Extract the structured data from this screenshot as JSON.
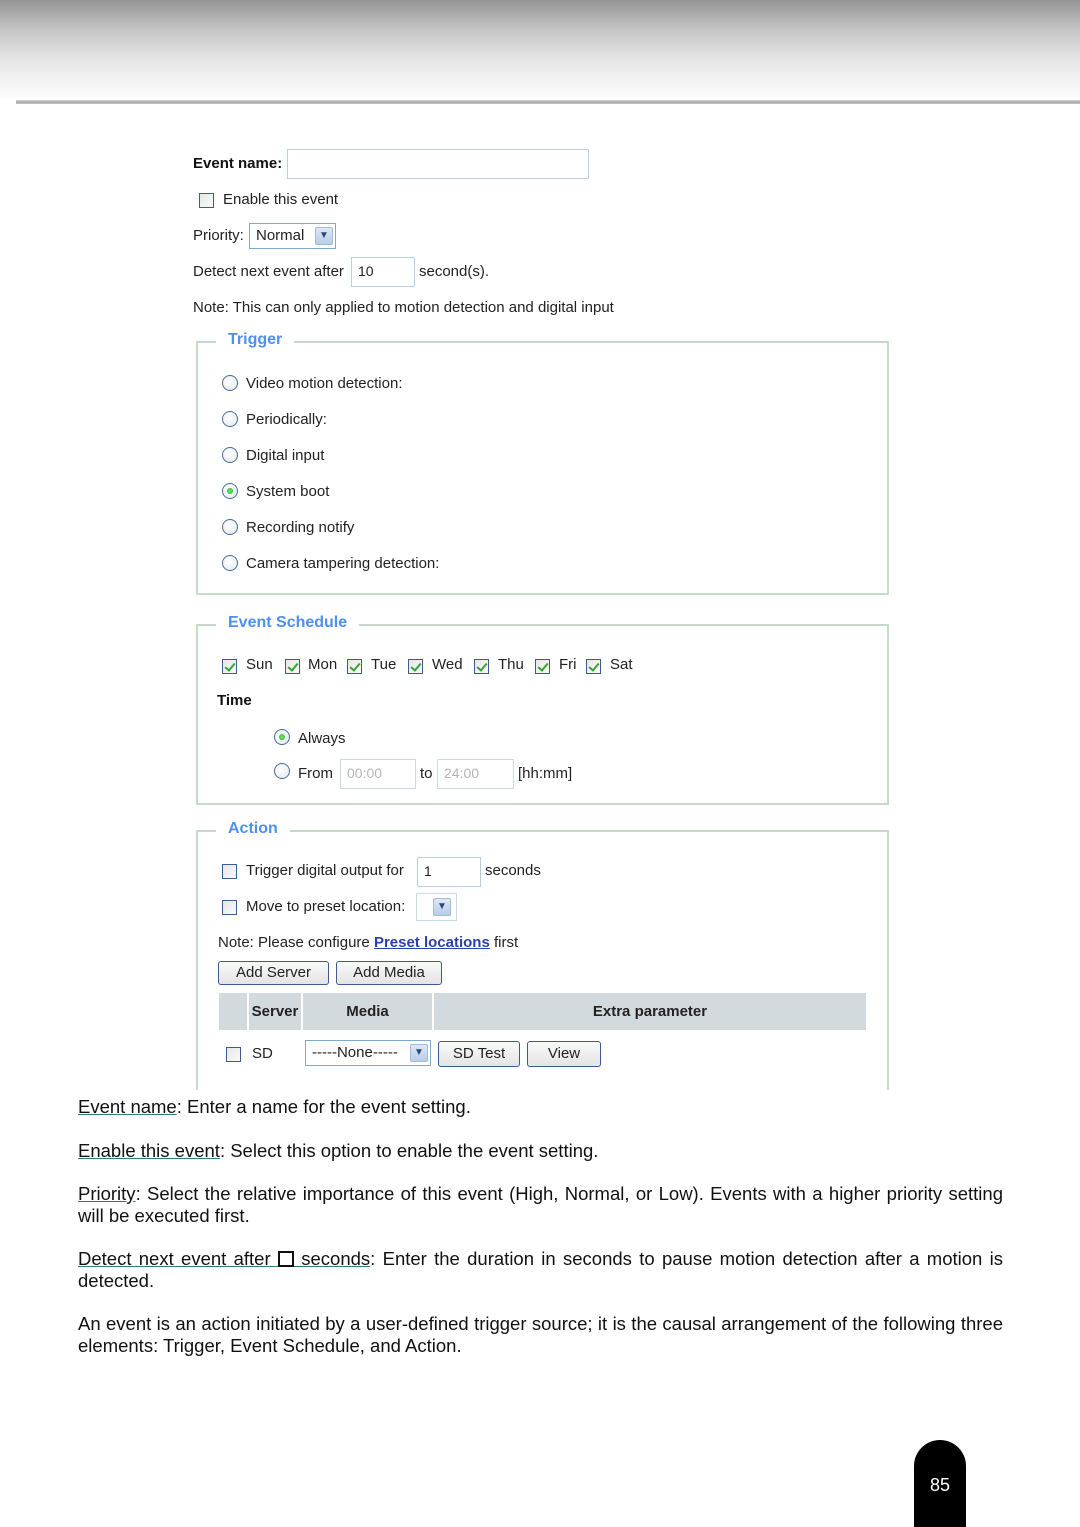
{
  "form": {
    "event_name_label": "Event name:",
    "event_name_value": "",
    "enable_event_label": "Enable this event",
    "enable_event_checked": false,
    "priority_label": "Priority:",
    "priority_value": "Normal",
    "detect_label": "Detect next event after",
    "detect_value": "10",
    "detect_unit": "second(s).",
    "note": "Note: This can only applied to motion detection and digital input"
  },
  "trigger": {
    "legend": "Trigger",
    "options": [
      {
        "label": "Video motion detection:",
        "selected": false
      },
      {
        "label": "Periodically:",
        "selected": false
      },
      {
        "label": "Digital input",
        "selected": false
      },
      {
        "label": "System boot",
        "selected": true
      },
      {
        "label": "Recording notify",
        "selected": false
      },
      {
        "label": "Camera tampering detection:",
        "selected": false
      }
    ]
  },
  "schedule": {
    "legend": "Event Schedule",
    "days": [
      {
        "label": "Sun",
        "checked": true
      },
      {
        "label": "Mon",
        "checked": true
      },
      {
        "label": "Tue",
        "checked": true
      },
      {
        "label": "Wed",
        "checked": true
      },
      {
        "label": "Thu",
        "checked": true
      },
      {
        "label": "Fri",
        "checked": true
      },
      {
        "label": "Sat",
        "checked": true
      }
    ],
    "time_label": "Time",
    "always_label": "Always",
    "always_selected": true,
    "from_label": "From",
    "from_value": "00:00",
    "to_label": "to",
    "to_value": "24:00",
    "format_label": "[hh:mm]"
  },
  "action": {
    "legend": "Action",
    "trigger_output_label": "Trigger digital output for",
    "trigger_output_value": "1",
    "trigger_output_unit": "seconds",
    "preset_label": "Move to preset location:",
    "preset_value": "",
    "note_prefix": "Note: Please configure ",
    "note_link": "Preset locations",
    "note_suffix": " first",
    "add_server_label": "Add Server",
    "add_media_label": "Add Media",
    "table": {
      "headers": [
        "",
        "Server",
        "Media",
        "Extra parameter"
      ],
      "rows": [
        {
          "checked": false,
          "server": "SD",
          "media": "-----None-----",
          "buttons": [
            "SD Test",
            "View"
          ]
        }
      ]
    }
  },
  "descriptions": {
    "event_name_term": "Event name",
    "event_name_text": ": Enter a name for the event setting.",
    "enable_term": "Enable this event",
    "enable_text": ": Select this option to enable the event setting.",
    "priority_term": "Priority",
    "priority_text": ": Select the relative importance of this event (High, Normal, or Low). Events with a higher priority setting will be executed first.",
    "detect_term_a": "Detect next event after ",
    "detect_term_b": " seconds",
    "detect_text": ": Enter the duration in seconds to pause motion detection after a motion is detected.",
    "summary": "An event is an action initiated by a user-defined trigger source; it is the causal arrangement of the following three elements: Trigger, Event Schedule, and Action."
  },
  "page_number": "85"
}
